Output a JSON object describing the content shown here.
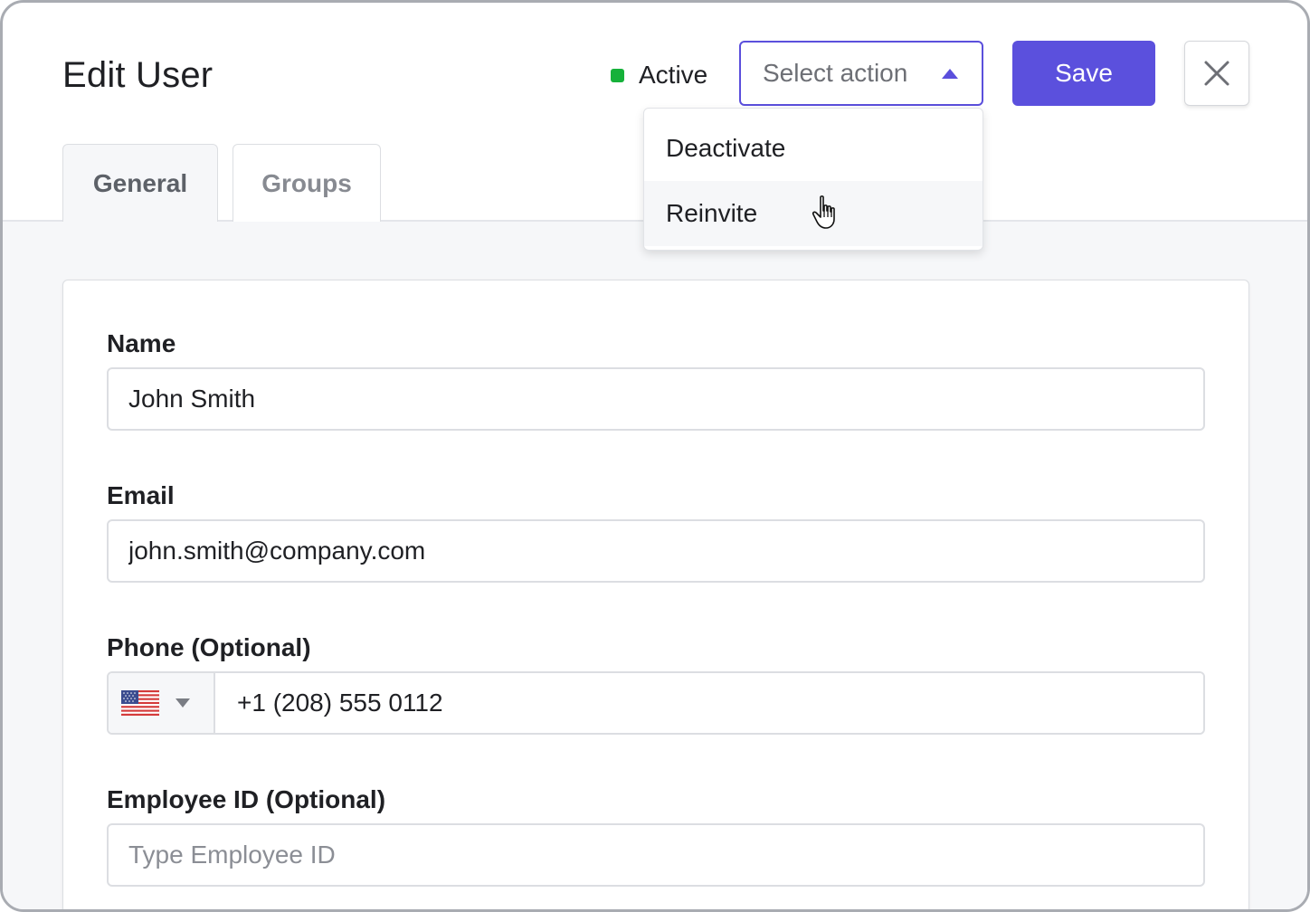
{
  "header": {
    "title": "Edit User",
    "status_label": "Active",
    "status_color": "#16b13a",
    "action_select": {
      "placeholder": "Select action",
      "options": [
        "Deactivate",
        "Reinvite"
      ],
      "hovered_option": "Reinvite"
    },
    "save_label": "Save",
    "close_icon": "close-icon"
  },
  "tabs": [
    {
      "label": "General",
      "active": true
    },
    {
      "label": "Groups",
      "active": false
    }
  ],
  "form": {
    "name": {
      "label": "Name",
      "value": "John Smith"
    },
    "email": {
      "label": "Email",
      "value": "john.smith@company.com"
    },
    "phone": {
      "label": "Phone (Optional)",
      "country_icon": "us-flag-icon",
      "value": "+1 (208) 555 0112"
    },
    "employee_id": {
      "label": "Employee ID (Optional)",
      "value": "",
      "placeholder": "Type Employee ID"
    }
  },
  "colors": {
    "accent": "#5b50dd",
    "status_active": "#16b13a"
  }
}
